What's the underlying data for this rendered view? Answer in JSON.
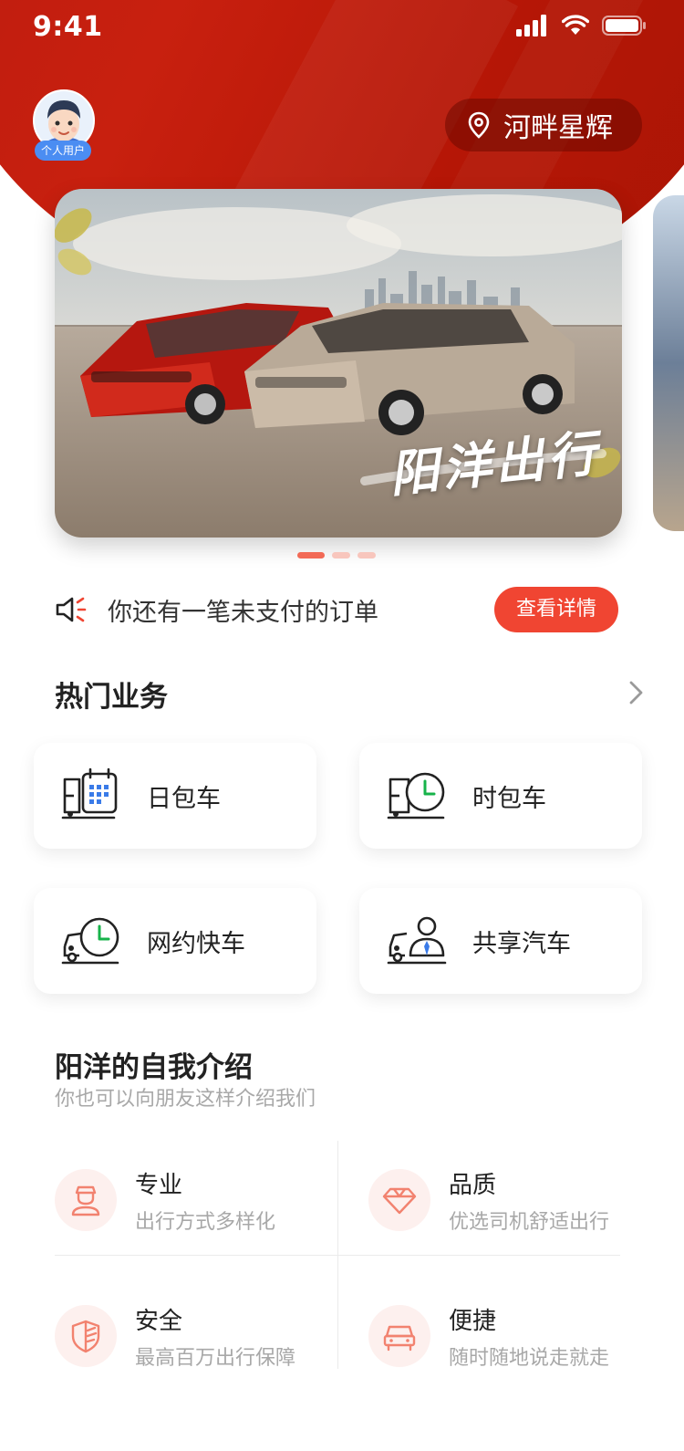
{
  "status_bar": {
    "time": "9:41"
  },
  "header": {
    "avatar_badge": "个人用户",
    "location": "河畔星辉"
  },
  "banner": {
    "title": "阳洋出行",
    "dot_count": 3,
    "active_index": 0
  },
  "notice": {
    "text": "你还有一笔未支付的订单",
    "button": "查看详情"
  },
  "hot_services": {
    "title": "热门业务",
    "items": [
      {
        "label": "日包车",
        "icon": "calendar-bus-icon"
      },
      {
        "label": "时包车",
        "icon": "clock-bus-icon"
      },
      {
        "label": "网约快车",
        "icon": "clock-car-icon"
      },
      {
        "label": "共享汽车",
        "icon": "driver-car-icon"
      }
    ]
  },
  "intro": {
    "title": "阳洋的自我介绍",
    "subtitle": "你也可以向朋友这样介绍我们",
    "features": [
      {
        "title": "专业",
        "desc": "出行方式多样化",
        "icon": "driver-icon"
      },
      {
        "title": "品质",
        "desc": "优选司机舒适出行",
        "icon": "diamond-icon"
      },
      {
        "title": "安全",
        "desc": "最高百万出行保障",
        "icon": "shield-icon"
      },
      {
        "title": "便捷",
        "desc": "随时随地说走就走",
        "icon": "car-front-icon"
      }
    ]
  },
  "colors": {
    "brand_red": "#c8200f",
    "accent": "#f04532",
    "icon_green": "#17b34a",
    "icon_blue": "#3a7be8",
    "feature_icon": "#f2826f"
  }
}
